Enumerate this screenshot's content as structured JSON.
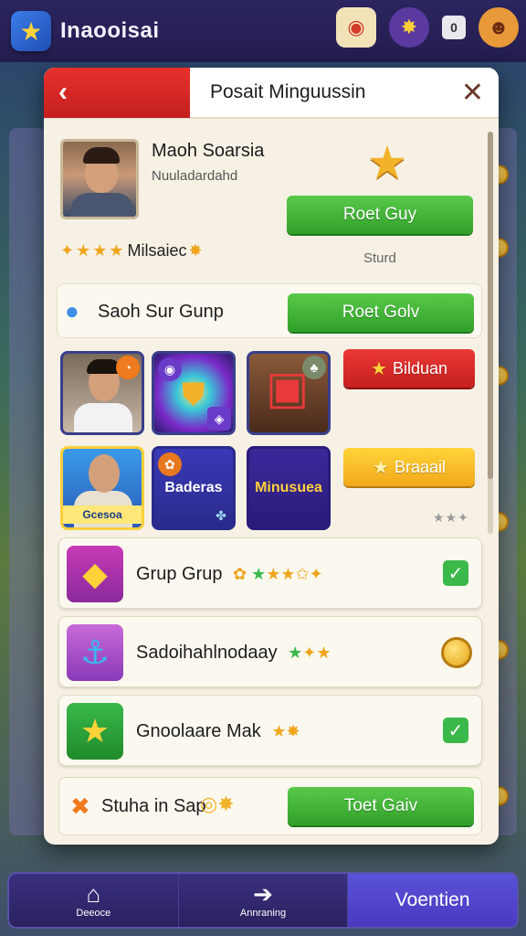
{
  "app": {
    "title": "Inaooisai"
  },
  "topbar": {
    "box_label": "0"
  },
  "modal": {
    "title": "Posait Minguussin",
    "back_glyph": "‹",
    "close_glyph": "✕"
  },
  "profile": {
    "name": "Maoh Soarsia",
    "subtitle": "Nuuladardahd",
    "button": "Roet Guy",
    "rating_label": "Milsaiec",
    "status": "Sturd"
  },
  "group": {
    "label": "Saoh Sur Gunp",
    "button": "Roet Golv"
  },
  "tiles": {
    "d_caption": "Gcesoa",
    "e_text": "Baderas",
    "f_text": "Minusuea",
    "red_button": "Bilduan",
    "yellow_button": "Braaail"
  },
  "list": [
    {
      "label": "Grup Grup",
      "state": "checked"
    },
    {
      "label": "Sadoihahlnodaay",
      "state": "coin"
    },
    {
      "label": "Gnoolaare Mak",
      "state": "checked"
    }
  ],
  "action": {
    "label": "Stuha in Sap",
    "button": "Toet Gaiv"
  },
  "nav": [
    {
      "label": "Deeoce",
      "icon": "house-icon"
    },
    {
      "label": "Annraning",
      "icon": "arrow-icon"
    },
    {
      "label": "Voentien",
      "icon": ""
    }
  ],
  "colors": {
    "accent_red": "#e8312d",
    "accent_green": "#31a029",
    "accent_yellow": "#f2a81a",
    "nav_bg": "#2a2260"
  }
}
